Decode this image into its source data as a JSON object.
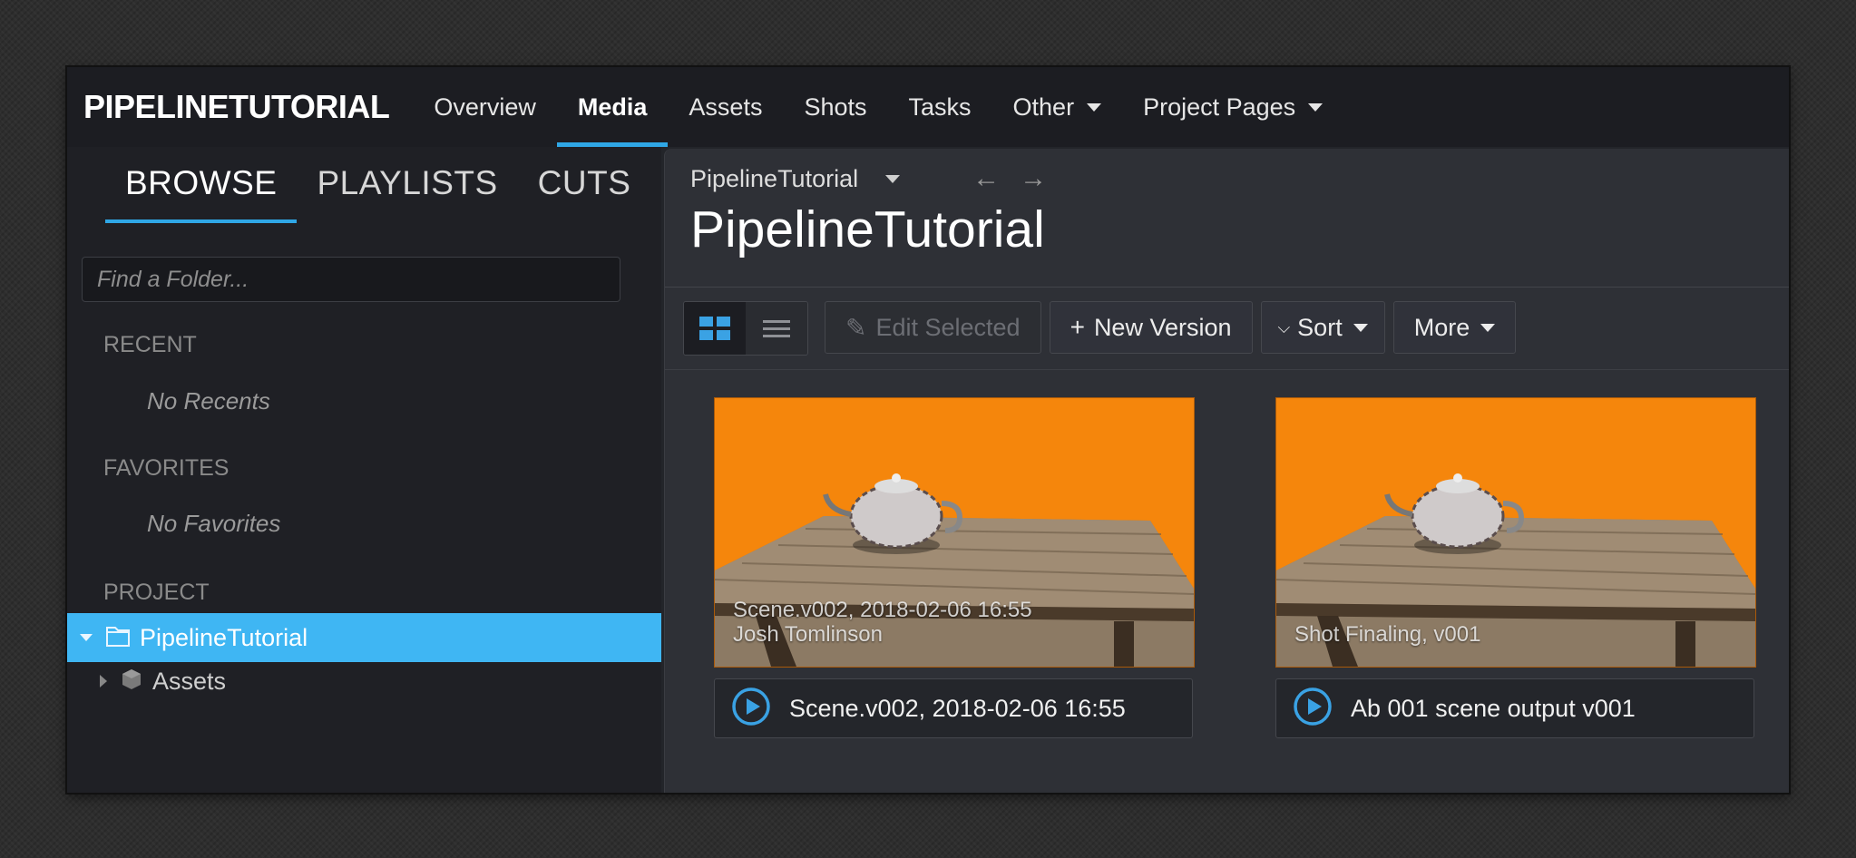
{
  "nav": {
    "brand": "PIPELINETUTORIAL",
    "items": [
      {
        "label": "Overview"
      },
      {
        "label": "Media"
      },
      {
        "label": "Assets"
      },
      {
        "label": "Shots"
      },
      {
        "label": "Tasks"
      },
      {
        "label": "Other"
      },
      {
        "label": "Project Pages"
      }
    ],
    "active": "Media"
  },
  "sidebar": {
    "tabs": [
      {
        "label": "BROWSE"
      },
      {
        "label": "PLAYLISTS"
      },
      {
        "label": "CUTS"
      }
    ],
    "active_tab": "BROWSE",
    "search_placeholder": "Find a Folder...",
    "recent_title": "RECENT",
    "recent_empty": "No Recents",
    "favorites_title": "FAVORITES",
    "favorites_empty": "No Favorites",
    "project_title": "PROJECT",
    "tree": [
      {
        "label": "PipelineTutorial",
        "selected": true
      },
      {
        "label": "Assets",
        "selected": false
      }
    ]
  },
  "main": {
    "breadcrumb": "PipelineTutorial",
    "title": "PipelineTutorial",
    "toolbar": {
      "edit_selected": "Edit Selected",
      "new_version": "New Version",
      "sort": "Sort",
      "more": "More"
    },
    "cards": [
      {
        "overlay_line1": "Scene.v002, 2018-02-06 16:55",
        "overlay_line2": "Josh Tomlinson",
        "title": "Scene.v002, 2018-02-06 16:55"
      },
      {
        "overlay_line1": "Shot Finaling, v001",
        "overlay_line2": "",
        "title": "Ab 001 scene output v001"
      }
    ]
  },
  "colors": {
    "accent": "#2fa7e6",
    "selected_row": "#3fb6f3",
    "thumbnail_bg": "#f5860c"
  }
}
